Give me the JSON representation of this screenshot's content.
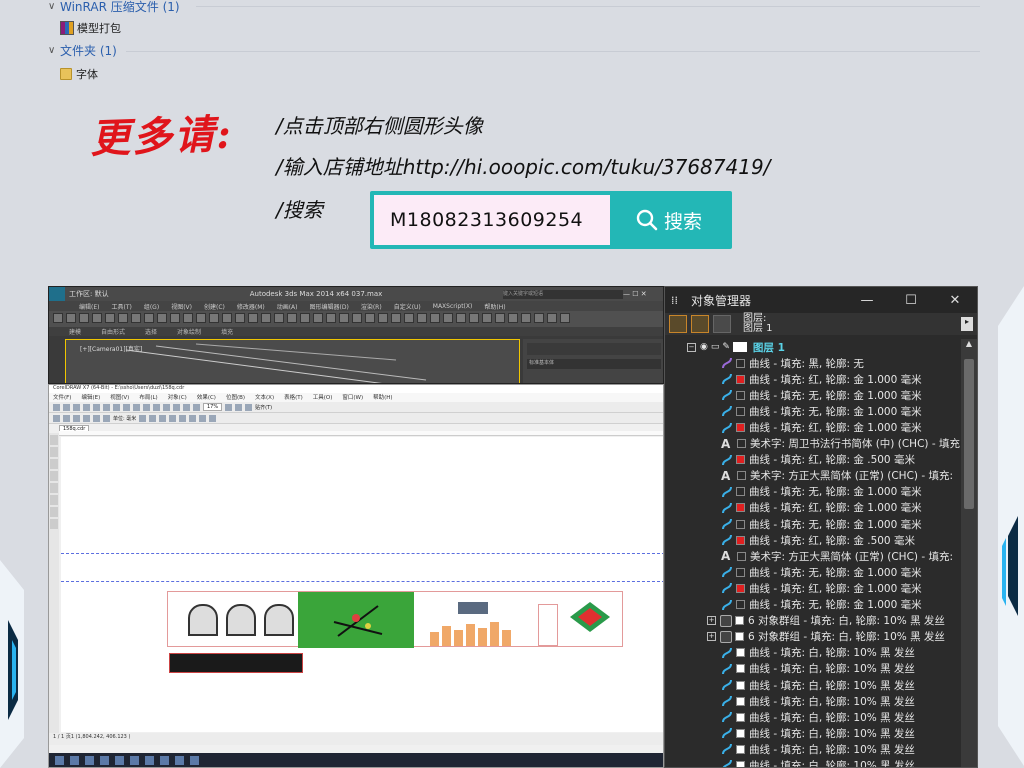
{
  "explorer": {
    "groups": [
      {
        "label": "WinRAR 压缩文件 (1)",
        "items": [
          "模型打包"
        ]
      },
      {
        "label": "文件夹 (1)",
        "items": [
          "字体"
        ]
      }
    ]
  },
  "promo": {
    "headline": "更多请:",
    "lines": [
      "/点击顶部右侧圆形头像",
      "/输入店铺地址http://hi.ooopic.com/tuku/37687419/",
      "/搜索"
    ],
    "search_value": "M18082313609254",
    "search_button": "搜索"
  },
  "max_window": {
    "title": "Autodesk 3ds Max  2014 x64      037.max",
    "workspace": "工作区: 默认",
    "search_placeholder": "键入关键字或短语",
    "menu": [
      "编辑(E)",
      "工具(T)",
      "组(G)",
      "视图(V)",
      "创建(C)",
      "修改器(M)",
      "动画(A)",
      "图形编辑器(D)",
      "渲染(R)",
      "自定义(U)",
      "MAXScript(X)",
      "帮助(H)"
    ],
    "tabs": [
      "建模",
      "自由形式",
      "选择",
      "对象绘制",
      "填充"
    ],
    "viewport_label": "[+][Camera01][真实]",
    "side_label": "标准基本体"
  },
  "cdr_window": {
    "title": "CorelDRAW X7 (64-Bit) - E:\\ssho\\Users\\duzi\\158q.cdr",
    "menu": [
      "文件(F)",
      "编辑(E)",
      "视图(V)",
      "布局(L)",
      "对象(C)",
      "效果(C)",
      "位图(B)",
      "文本(X)",
      "表格(T)",
      "工具(O)",
      "窗口(W)",
      "帮助(H)"
    ],
    "zoom": "17%",
    "snap": "贴齐(T)",
    "unit": "单位: 毫米",
    "doc_tab": "158q.cdr",
    "page": "页1",
    "page_nav": "1 / 1",
    "status": "(1,804.242, 406.123 )"
  },
  "object_manager": {
    "title": "对象管理器",
    "page_info": [
      "图层:",
      "图层 1"
    ],
    "layer": "图层 1",
    "rows": [
      {
        "kind": "curve",
        "color": "#2a2a2a",
        "text": "曲线 - 填充: 黑, 轮廓: 无"
      },
      {
        "kind": "curve",
        "color": "#e02020",
        "text": "曲线 - 填充: 红, 轮廓: 金  1.000 毫米"
      },
      {
        "kind": "curve",
        "color": "#2a2a2a",
        "text": "曲线 - 填充: 无, 轮廓: 金  1.000 毫米"
      },
      {
        "kind": "curve",
        "color": "#2a2a2a",
        "text": "曲线 - 填充: 无, 轮廓: 金  1.000 毫米"
      },
      {
        "kind": "curve",
        "color": "#e02020",
        "text": "曲线 - 填充: 红, 轮廓: 金  1.000 毫米"
      },
      {
        "kind": "text",
        "color": "#2a2a2a",
        "text": "美术字: 周卫书法行书简体 (中) (CHC) - 填充"
      },
      {
        "kind": "curve",
        "color": "#e02020",
        "text": "曲线 - 填充: 红, 轮廓: 金  .500 毫米"
      },
      {
        "kind": "text",
        "color": "#2a2a2a",
        "text": "美术字: 方正大黑简体 (正常) (CHC) - 填充:"
      },
      {
        "kind": "curve",
        "color": "#2a2a2a",
        "text": "曲线 - 填充: 无, 轮廓: 金  1.000 毫米"
      },
      {
        "kind": "curve",
        "color": "#e02020",
        "text": "曲线 - 填充: 红, 轮廓: 金  1.000 毫米"
      },
      {
        "kind": "curve",
        "color": "#2a2a2a",
        "text": "曲线 - 填充: 无, 轮廓: 金  1.000 毫米"
      },
      {
        "kind": "curve",
        "color": "#e02020",
        "text": "曲线 - 填充: 红, 轮廓: 金  .500 毫米"
      },
      {
        "kind": "text",
        "color": "#2a2a2a",
        "text": "美术字: 方正大黑简体 (正常) (CHC) - 填充:"
      },
      {
        "kind": "curve",
        "color": "#2a2a2a",
        "text": "曲线 - 填充: 无, 轮廓: 金  1.000 毫米"
      },
      {
        "kind": "curve",
        "color": "#e02020",
        "text": "曲线 - 填充: 红, 轮廓: 金  1.000 毫米"
      },
      {
        "kind": "curve",
        "color": "#2a2a2a",
        "text": "曲线 - 填充: 无, 轮廓: 金  1.000 毫米"
      },
      {
        "kind": "group",
        "color": "#ffffff",
        "text": "6 对象群组 - 填充: 白, 轮廓: 10% 黑  发丝"
      },
      {
        "kind": "group",
        "color": "#ffffff",
        "text": "6 对象群组 - 填充: 白, 轮廓: 10% 黑  发丝"
      },
      {
        "kind": "curve",
        "color": "#ffffff",
        "text": "曲线 - 填充: 白, 轮廓: 10% 黑  发丝"
      },
      {
        "kind": "curve",
        "color": "#ffffff",
        "text": "曲线 - 填充: 白, 轮廓: 10% 黑  发丝"
      },
      {
        "kind": "curve",
        "color": "#ffffff",
        "text": "曲线 - 填充: 白, 轮廓: 10% 黑  发丝"
      },
      {
        "kind": "curve",
        "color": "#ffffff",
        "text": "曲线 - 填充: 白, 轮廓: 10% 黑  发丝"
      },
      {
        "kind": "curve",
        "color": "#ffffff",
        "text": "曲线 - 填充: 白, 轮廓: 10% 黑  发丝"
      },
      {
        "kind": "curve",
        "color": "#ffffff",
        "text": "曲线 - 填充: 白, 轮廓: 10% 黑  发丝"
      },
      {
        "kind": "curve",
        "color": "#ffffff",
        "text": "曲线 - 填充: 白, 轮廓: 10% 黑  发丝"
      },
      {
        "kind": "curve",
        "color": "#ffffff",
        "text": "曲线 - 填充: 白, 轮廓: 10% 黑  发丝"
      }
    ]
  }
}
